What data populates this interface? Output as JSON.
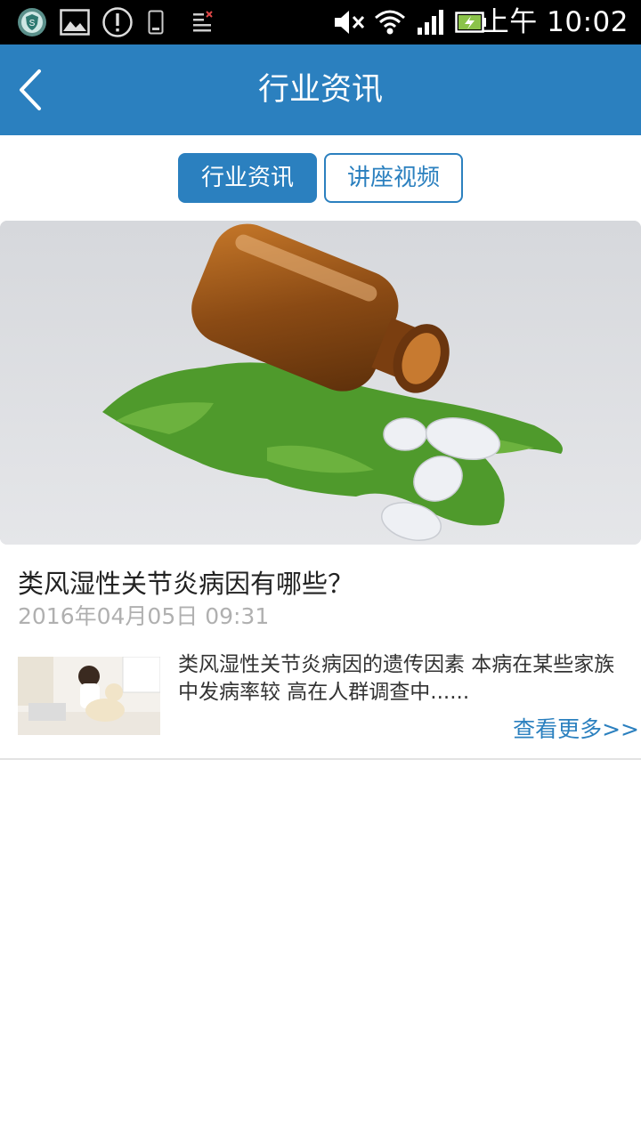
{
  "status_bar": {
    "time": "上午 10:02",
    "left_icons": [
      "shield-app-icon",
      "image-notification-icon",
      "alert-notification-icon",
      "phone-notification-icon",
      "task-list-notification-icon"
    ],
    "right_icons": [
      "mute-icon",
      "wifi-icon",
      "signal-icon",
      "battery-icon"
    ]
  },
  "header": {
    "title": "行业资讯",
    "back_icon": "chevron-left-icon"
  },
  "tabs": [
    {
      "label": "行业资讯",
      "active": true
    },
    {
      "label": "讲座视频",
      "active": false
    }
  ],
  "article": {
    "title": "类风湿性关节炎病因有哪些？",
    "date": "2016年04月05日 09:31",
    "summary": "类风湿性关节炎病因的遗传因素 本病在某些家族中发病率较 高在人群调查中......",
    "more_label": "查看更多>>"
  },
  "colors": {
    "primary": "#2b80bf",
    "status_bar": "#000000",
    "date_text": "#b0b0b0"
  }
}
